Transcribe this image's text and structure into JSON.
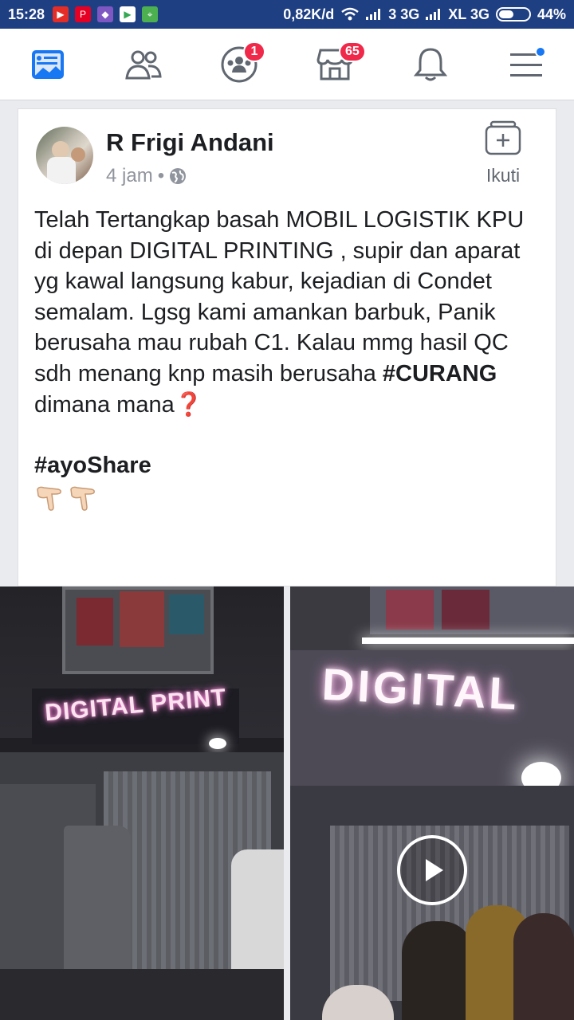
{
  "status_bar": {
    "time": "15:28",
    "speed": "0,82K/d",
    "network1": "3 3G",
    "network2": "XL 3G",
    "battery": "44%",
    "bg_color": "#1f3f83",
    "app_icons": [
      "youtube-icon",
      "pinterest-icon",
      "app-icon",
      "play-store-icon",
      "maps-icon"
    ]
  },
  "nav": {
    "items": [
      {
        "name": "news-feed",
        "icon": "news-feed-icon"
      },
      {
        "name": "friends",
        "icon": "friends-icon"
      },
      {
        "name": "groups",
        "icon": "groups-icon",
        "badge": "1"
      },
      {
        "name": "marketplace",
        "icon": "marketplace-icon",
        "badge": "65"
      },
      {
        "name": "notifications",
        "icon": "bell-icon"
      },
      {
        "name": "menu",
        "icon": "menu-icon"
      }
    ],
    "accent": "#1877f2"
  },
  "post": {
    "author": "R Frigi Andani",
    "time": "4 jam",
    "separator": "•",
    "privacy_icon": "globe-icon",
    "follow_label": "Ikuti",
    "text_main": "Telah Tertangkap basah MOBIL LOGISTIK KPU di depan DIGITAL PRINTING ,  supir dan aparat yg kawal langsung kabur, kejadian di Condet semalam. Lgsg kami amankan barbuk, Panik berusaha mau rubah C1. Kalau mmg hasil QC sdh menang knp masih berusaha ",
    "text_bold": "#CURANG",
    "text_end": "dimana mana",
    "question_emoji": "❓",
    "hashtag": "#ayoShare",
    "pointing_emojis": [
      "👉",
      "👉"
    ]
  },
  "media": {
    "left_sign": "DIGITAL PRINT",
    "right_sign": "DIGITAL"
  }
}
